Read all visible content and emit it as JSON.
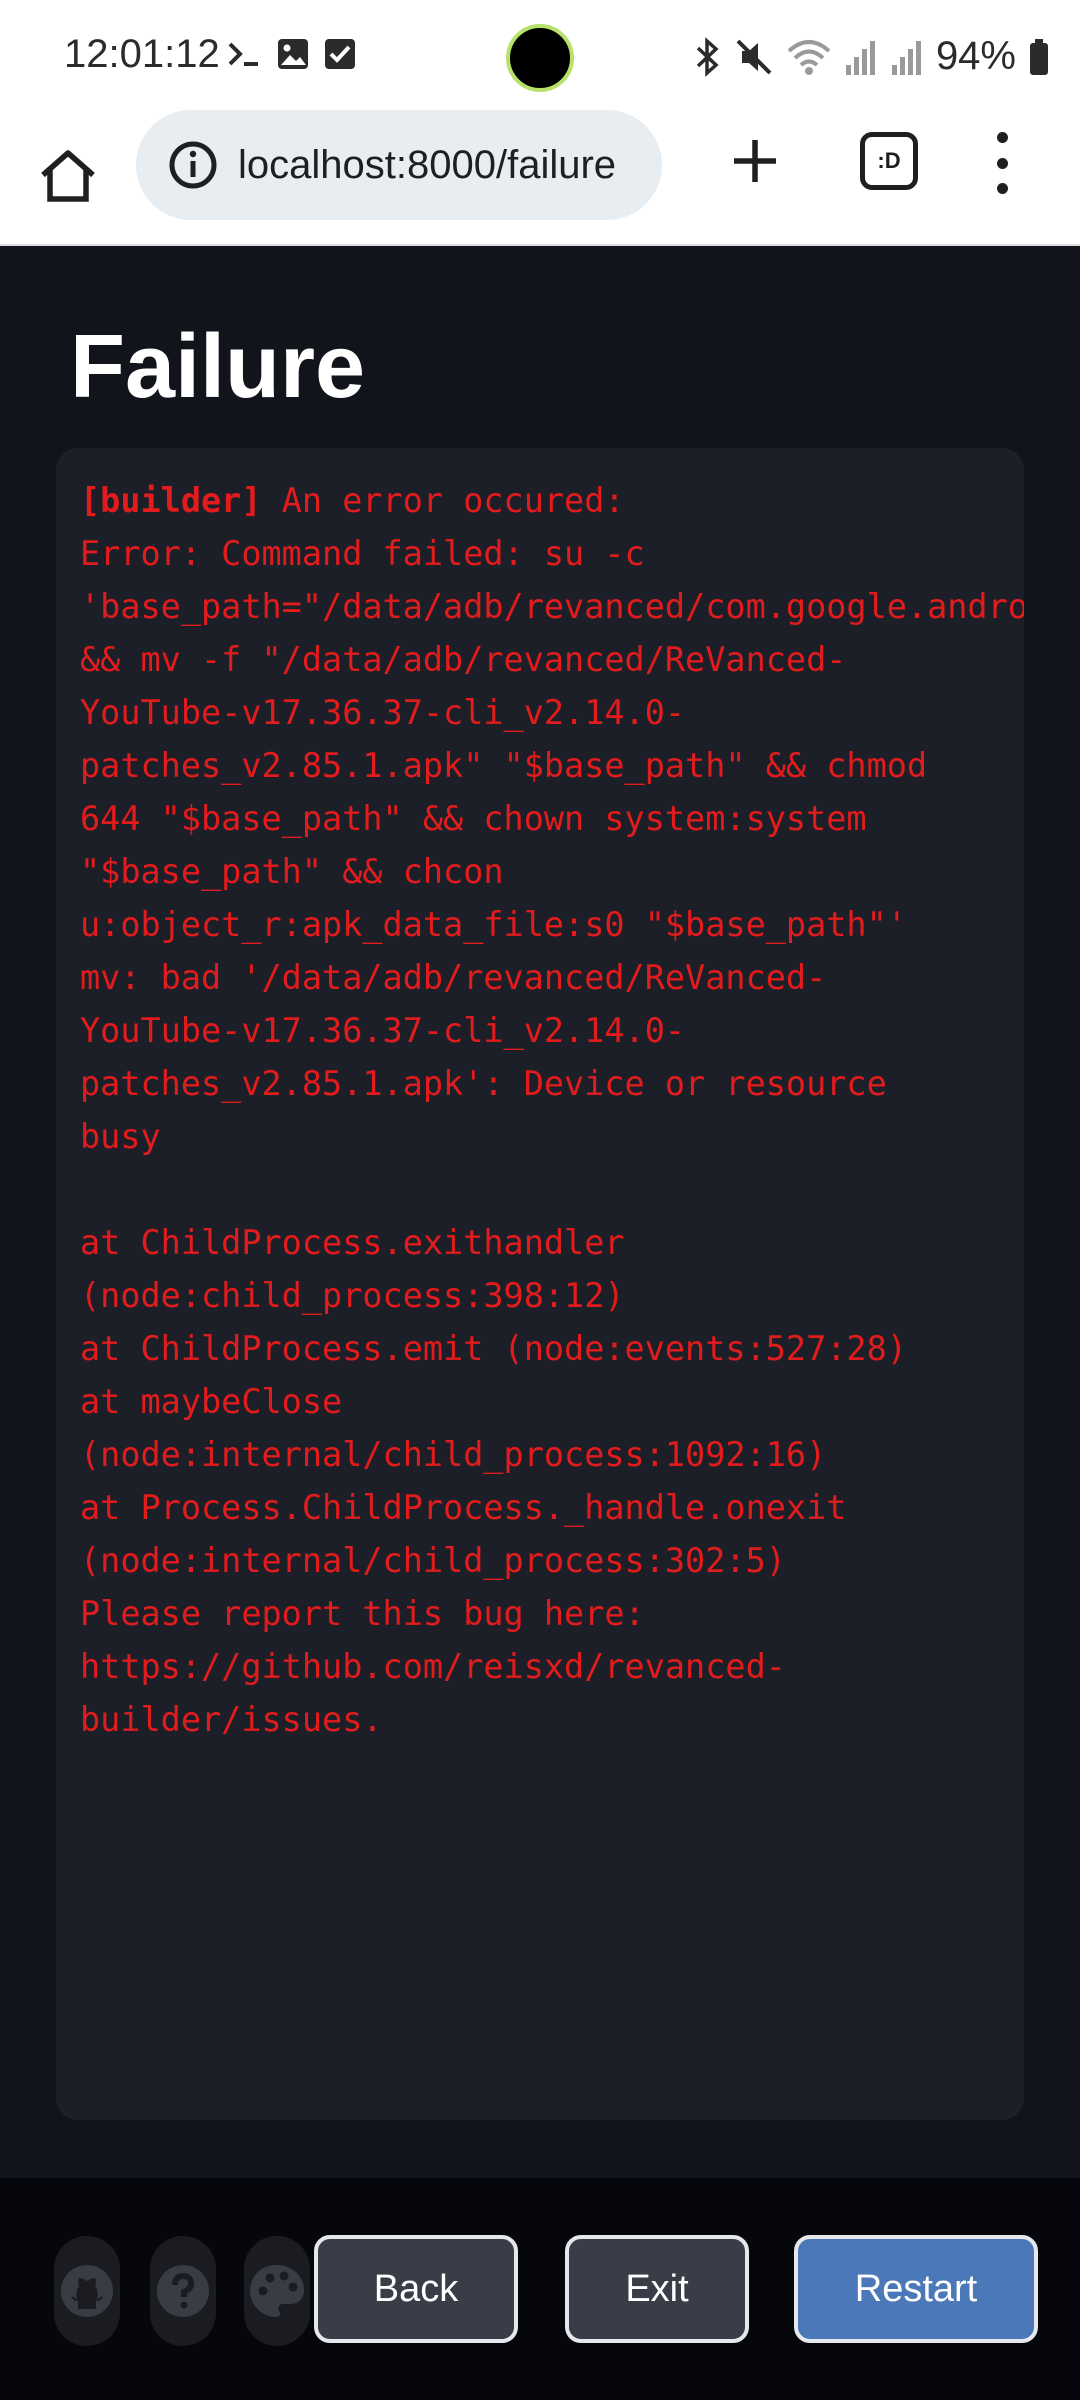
{
  "status_bar": {
    "time": "12:01:12",
    "battery": "94%",
    "left_icons": [
      "terminal-icon",
      "image-icon",
      "checkbox-icon"
    ],
    "right_icons": [
      "bluetooth-icon",
      "mute-icon",
      "wifi-icon",
      "signal-icon",
      "signal-icon",
      "battery-icon"
    ]
  },
  "browser": {
    "url": "localhost:8000/failure",
    "tabs_label": ":D"
  },
  "page": {
    "title": "Failure",
    "log": {
      "tag": "[builder]",
      "first_line": " An error occured:",
      "body": "Error: Command failed: su -c\n'base_path=\"/data/adb/revanced/com.google.android.youtube.apk\"\n&& mv -f \"/data/adb/revanced/ReVanced-\nYouTube-v17.36.37-cli_v2.14.0-\npatches_v2.85.1.apk\" \"$base_path\" && chmod\n644 \"$base_path\" && chown system:system\n\"$base_path\" && chcon\nu:object_r:apk_data_file:s0 \"$base_path\"'\nmv: bad '/data/adb/revanced/ReVanced-\nYouTube-v17.36.37-cli_v2.14.0-\npatches_v2.85.1.apk': Device or resource\nbusy\n\nat ChildProcess.exithandler\n(node:child_process:398:12)\nat ChildProcess.emit (node:events:527:28)\nat maybeClose\n(node:internal/child_process:1092:16)\nat Process.ChildProcess._handle.onexit\n(node:internal/child_process:302:5)\nPlease report this bug here:\nhttps://github.com/reisxd/revanced-\nbuilder/issues."
    }
  },
  "footer": {
    "icons": [
      "github-icon",
      "help-icon",
      "palette-icon"
    ],
    "back_label": "Back",
    "exit_label": "Exit",
    "restart_label": "Restart"
  },
  "colors": {
    "background": "#11141b",
    "panel": "#1c1f28",
    "error_text": "#e21c1c",
    "restart_button": "#4a78b8",
    "secondary_button": "#3a3c48"
  }
}
